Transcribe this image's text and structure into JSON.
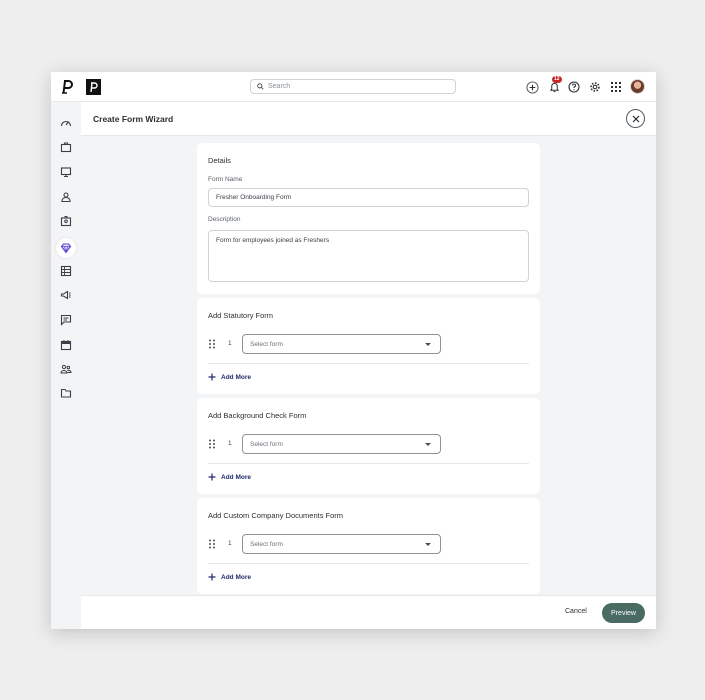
{
  "app": {
    "logo_letter": "P",
    "search_placeholder": "Search",
    "notification_count": "12"
  },
  "panel": {
    "title": "Create Form Wizard"
  },
  "details": {
    "heading": "Details",
    "form_name_label": "Form Name",
    "form_name_value": "Fresher Onboarding Form",
    "description_label": "Description",
    "description_value": "Form for employees joined as Freshers"
  },
  "sections": [
    {
      "title": "Add Statutory Form",
      "row_number": "1",
      "select_placeholder": "Select form",
      "add_more": "Add More"
    },
    {
      "title": "Add Background Check Form",
      "row_number": "1",
      "select_placeholder": "Select form",
      "add_more": "Add More"
    },
    {
      "title": "Add Custom Company Documents Form",
      "row_number": "1",
      "select_placeholder": "Select form",
      "add_more": "Add More"
    }
  ],
  "footer": {
    "cancel_label": "Cancel",
    "preview_label": "Preview"
  },
  "sidebar_icons": [
    "dashboard-icon",
    "briefcase-icon",
    "monitor-icon",
    "person-icon",
    "id-badge-icon",
    "diamond-icon",
    "table-icon",
    "megaphone-icon",
    "chat-icon",
    "calendar-icon",
    "people-icon",
    "folder-icon"
  ],
  "colors": {
    "accent": "#4a6b62",
    "link": "#1f2a6b",
    "badge": "#c62828",
    "active_icon": "#5b3fd1"
  }
}
